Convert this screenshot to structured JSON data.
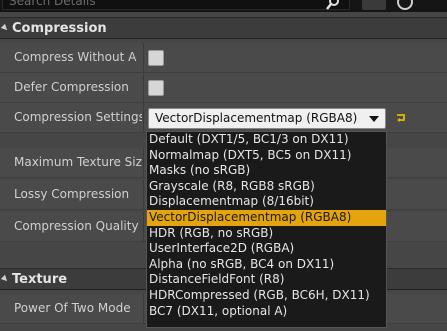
{
  "search": {
    "placeholder": "Search Details"
  },
  "sections": {
    "compression": {
      "title": "Compression",
      "rows": [
        {
          "label": "Compress Without A"
        },
        {
          "label": "Defer Compression"
        },
        {
          "label": "Compression Settings",
          "value": "VectorDisplacementmap (RGBA8)"
        },
        {
          "label": "Maximum Texture Size"
        },
        {
          "label": "Lossy Compression"
        },
        {
          "label": "Compression Quality"
        }
      ]
    },
    "texture": {
      "title": "Texture",
      "rows": [
        {
          "label": "Power Of Two Mode"
        }
      ]
    }
  },
  "dropdown": {
    "options": [
      "Default (DXT1/5, BC1/3 on DX11)",
      "Normalmap (DXT5, BC5 on DX11)",
      "Masks (no sRGB)",
      "Grayscale (R8, RGB8 sRGB)",
      "Displacementmap (8/16bit)",
      "VectorDisplacementmap (RGBA8)",
      "HDR (RGB, no sRGB)",
      "UserInterface2D (RGBA)",
      "Alpha (no sRGB, BC4 on DX11)",
      "DistanceFieldFont (R8)",
      "HDRCompressed (RGB, BC6H, DX11)",
      "BC7 (DX11, optional A)"
    ],
    "selected_index": 5
  },
  "colors": {
    "highlight": "#e3a40c",
    "panel": "#4a4a4a",
    "header": "#3c3c3c"
  }
}
